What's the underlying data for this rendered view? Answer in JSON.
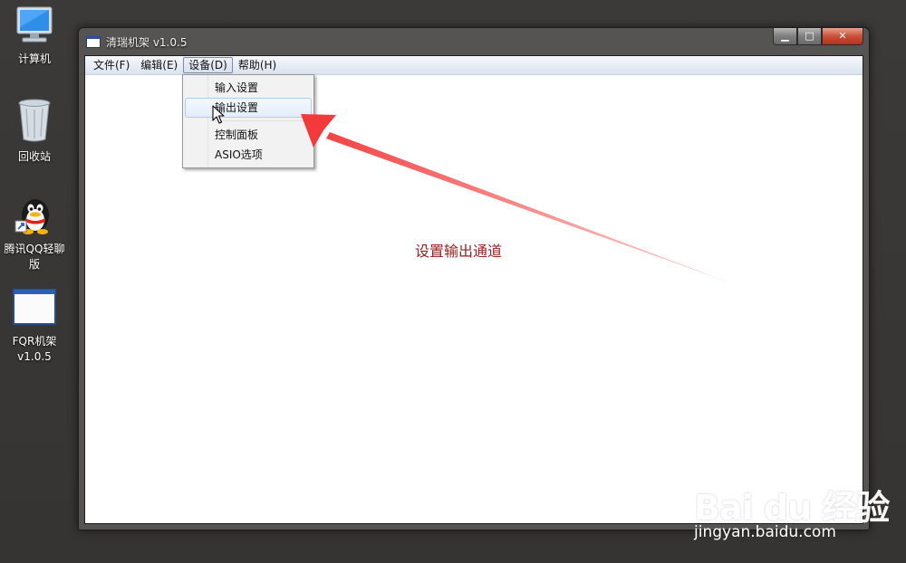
{
  "desktop": {
    "icons": [
      {
        "label": "计算机"
      },
      {
        "label": "回收站"
      },
      {
        "label": "腾讯QQ轻聊版"
      },
      {
        "label": "FQR机架 v1.0.5"
      }
    ]
  },
  "window": {
    "title": "清瑞机架 v1.0.5",
    "caption": {
      "minimize": "▁",
      "maximize": "□",
      "close": "✕"
    },
    "menubar": [
      {
        "label": "文件(F)"
      },
      {
        "label": "编辑(E)"
      },
      {
        "label": "设备(D)"
      },
      {
        "label": "帮助(H)"
      }
    ],
    "open_menu": {
      "items": [
        {
          "label": "输入设置"
        },
        {
          "label": "输出设置"
        },
        {
          "label": "控制面板"
        },
        {
          "label": "ASIO选项"
        }
      ],
      "hovered_index": 1
    }
  },
  "annotation": {
    "text": "设置输出通道",
    "color": "#9a1f22",
    "arrow_color": "#f23a3a"
  },
  "watermark": {
    "logo": "Bai du 经验",
    "url": "jingyan.baidu.com"
  },
  "colors": {
    "desktop_bg": "#3a3836",
    "window_frame": "#565452",
    "menu_hover_border": "#aecdef",
    "close_button": "#c9503a"
  }
}
